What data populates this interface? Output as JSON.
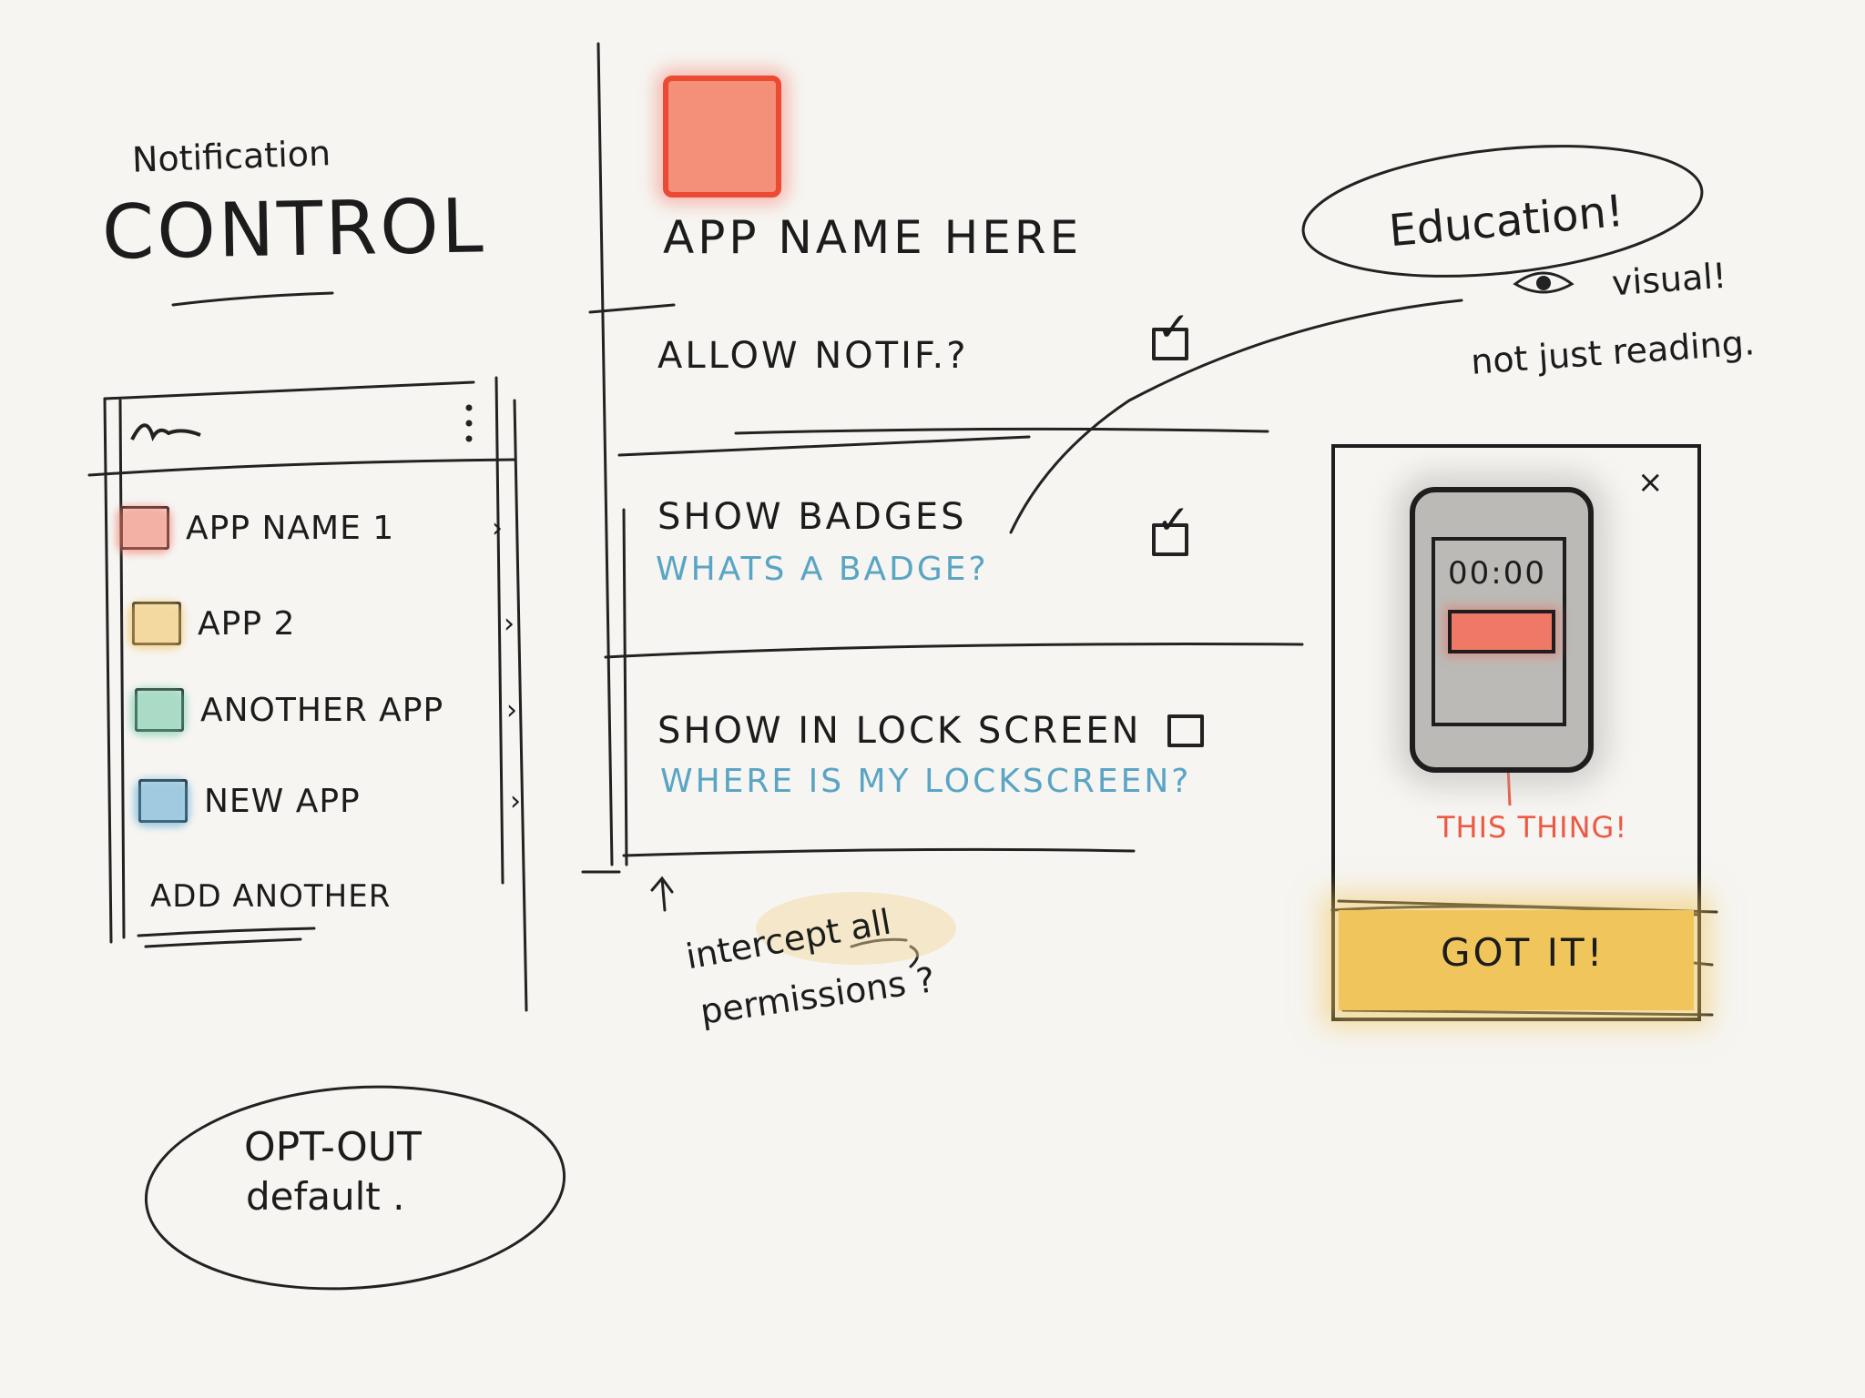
{
  "title": {
    "small": "Notification",
    "big": "CONTROL"
  },
  "app_list": {
    "items": [
      {
        "label": "APP NAME 1",
        "color": "#f27a68"
      },
      {
        "label": "APP 2",
        "color": "#f2c35e"
      },
      {
        "label": "ANOTHER APP",
        "color": "#6cc7a5"
      },
      {
        "label": "NEW APP",
        "color": "#5aa8d2"
      }
    ],
    "chevron": "›",
    "add_label": "ADD ANOTHER",
    "menu_icon": "kebab-menu-icon",
    "logo_icon": "squiggle-logo-icon"
  },
  "opt_out": {
    "line1": "OPT-OUT",
    "line2": "default ."
  },
  "settings": {
    "app_title": "APP NAME HERE",
    "icon_color": "#ec4a32",
    "items": [
      {
        "label": "ALLOW NOTIF.?",
        "help": "",
        "checked": true
      },
      {
        "label": "SHOW   BADGES",
        "help": "WHATS  A  BADGE?",
        "checked": true
      },
      {
        "label": "SHOW  IN  LOCK SCREEN",
        "help": "WHERE  IS MY LOCKSCREEN?",
        "checked": false
      }
    ],
    "check_glyph": "✓"
  },
  "notes": {
    "intercept_1": "intercept all",
    "intercept_2": "permissions ?"
  },
  "education": {
    "label": "Education!",
    "visual": "visual!",
    "reading": "not just reading.",
    "close": "×",
    "phone_time": "00:00",
    "this_thing": "THIS THING!",
    "got_it": "GOT IT!",
    "accent": "#f0c65c"
  }
}
